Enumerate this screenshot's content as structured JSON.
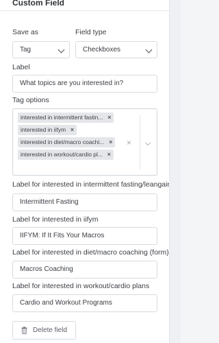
{
  "header": {
    "title": "Custom Field"
  },
  "save_as": {
    "label": "Save as",
    "value": "Tag"
  },
  "field_type": {
    "label": "Field type",
    "value": "Checkboxes"
  },
  "label_field": {
    "label": "Label",
    "value": "What topics are you interested in?"
  },
  "tag_options": {
    "label": "Tag options",
    "tags": [
      "interested in intermittent fastin...",
      "interested in iifym",
      "interested in diet/macro coachi...",
      "interested in workout/cardio pl..."
    ],
    "remove_glyph": "×",
    "clear_glyph": "×"
  },
  "option_labels": [
    {
      "label": "Label for interested in intermittent fasting/leangains",
      "value": "Intermittent Fasting"
    },
    {
      "label": "Label for interested in iifym",
      "value": "IIFYM: If It Fits Your Macros"
    },
    {
      "label": "Label for interested in diet/macro coaching (form)",
      "value": "Macros Coaching"
    },
    {
      "label": "Label for interested in workout/cardio plans",
      "value": "Cardio and Workout Programs"
    }
  ],
  "delete_button": {
    "label": "Delete field",
    "icon": "trash-icon"
  }
}
